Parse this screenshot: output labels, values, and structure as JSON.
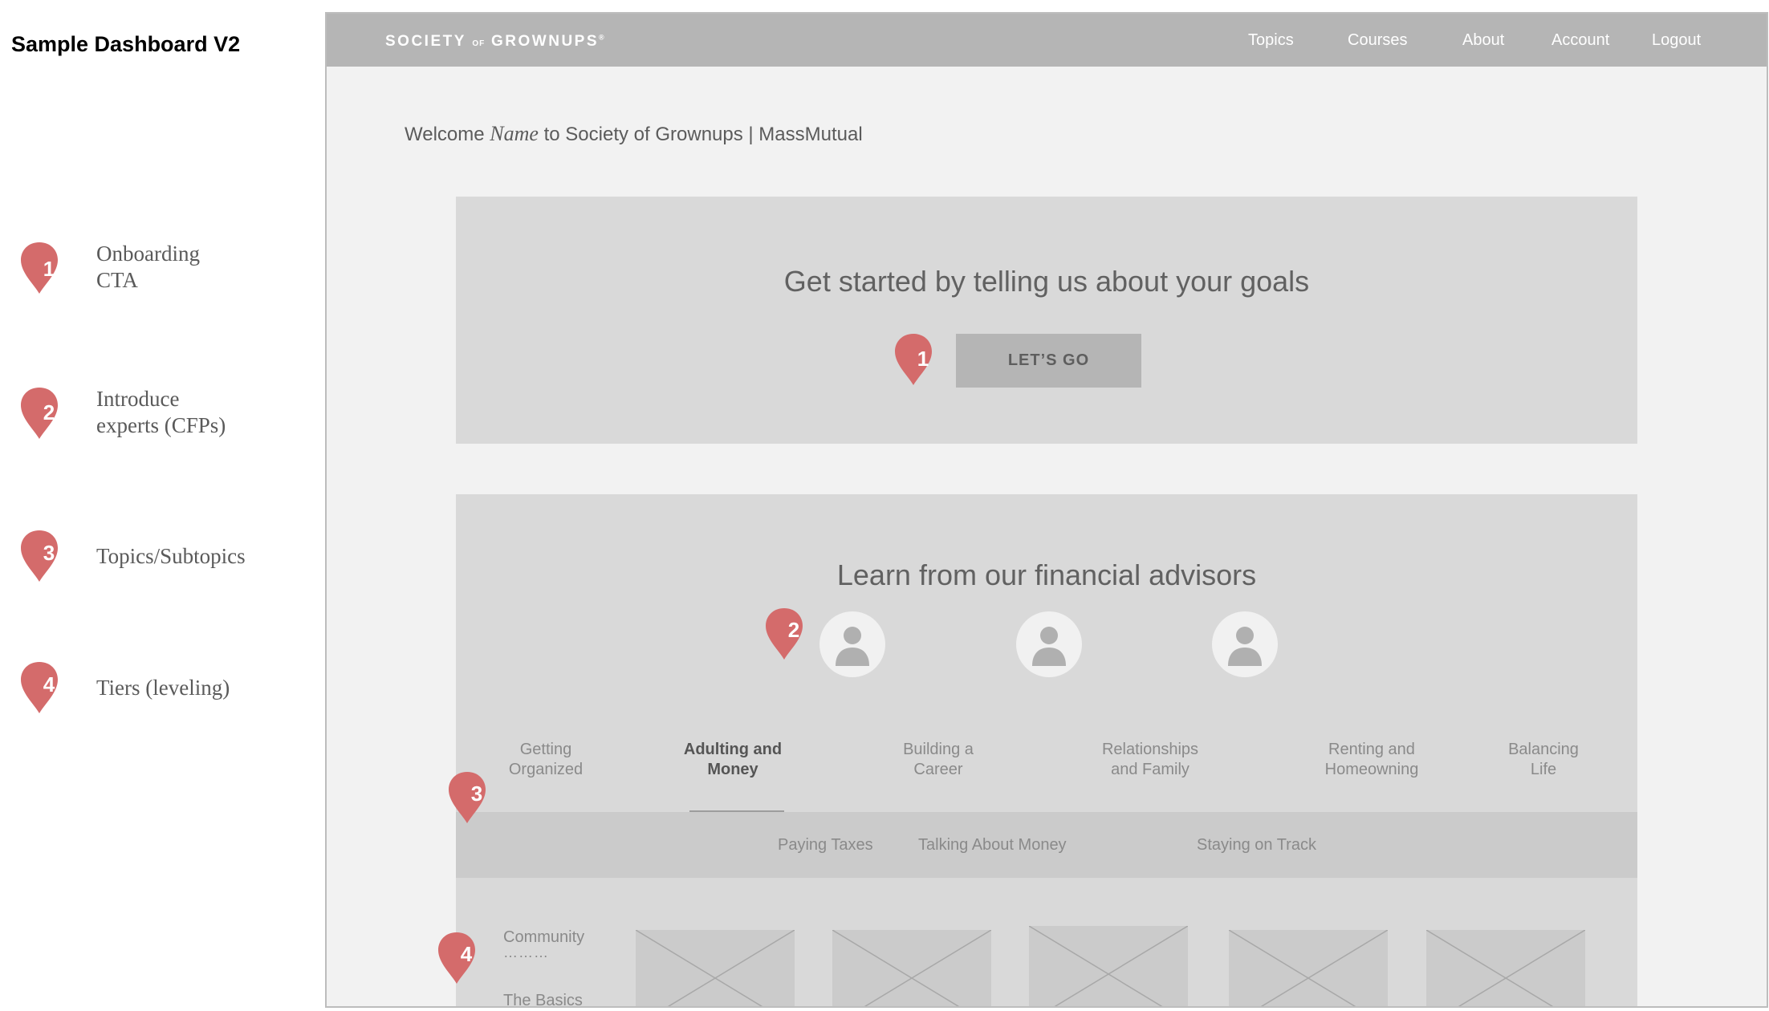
{
  "doc_title": "Sample Dashboard V2",
  "colors": {
    "pin": "#d46b6b",
    "topbar": "#b5b5b5",
    "panel": "#d9d9d9"
  },
  "legend": [
    {
      "number": "1",
      "label": "Onboarding\nCTA"
    },
    {
      "number": "2",
      "label": "Introduce\nexperts (CFPs)"
    },
    {
      "number": "3",
      "label": "Topics/Subtopics"
    },
    {
      "number": "4",
      "label": "Tiers (leveling)"
    }
  ],
  "header": {
    "logo": {
      "part1": "SOCIETY",
      "part2": "OF",
      "part3": "GROWNUPS",
      "mark": "®"
    },
    "nav": [
      "Topics",
      "Courses",
      "About",
      "Account",
      "Logout"
    ]
  },
  "welcome": {
    "prefix": "Welcome",
    "name": "Name",
    "suffix": "to Society of Grownups | MassMutual"
  },
  "onboarding": {
    "title": "Get started by telling us about your goals",
    "button": "LET’S GO"
  },
  "advisors": {
    "title": "Learn from our financial advisors",
    "icon": "person-icon"
  },
  "topics": [
    {
      "label": "Getting\nOrganized"
    },
    {
      "label": "Adulting and\nMoney",
      "active": true
    },
    {
      "label": "Building a\nCareer"
    },
    {
      "label": "Relationships\nand Family"
    },
    {
      "label": "Renting and\nHomeowning"
    },
    {
      "label": "Balancing\nLife"
    }
  ],
  "subtopics": [
    "Paying Taxes",
    "Talking About Money",
    "Staying on Track"
  ],
  "tiers": {
    "first": "Community",
    "dots": "………",
    "second": "The Basics"
  },
  "thumbnail_icon": "image-placeholder-icon"
}
